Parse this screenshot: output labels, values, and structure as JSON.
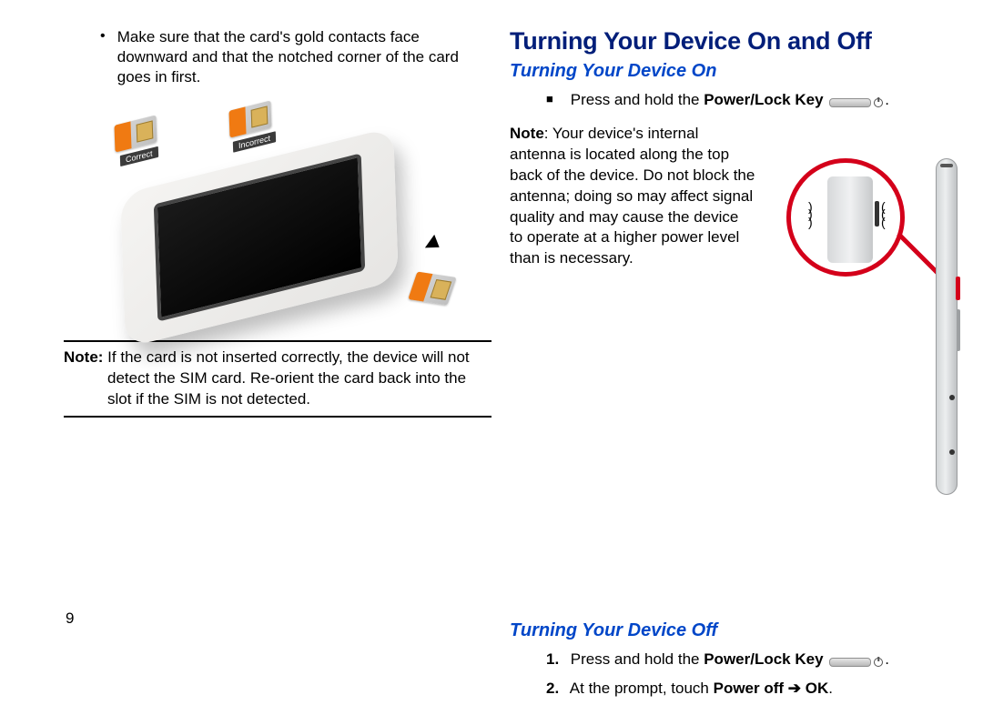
{
  "left": {
    "bullet": "Make sure that the card's gold contacts face downward and that the notched corner of the card goes in first.",
    "sim_correct_label": "Correct",
    "sim_incorrect_label": "Incorrect",
    "note_label": "Note:",
    "note_body_first": " If the card is not inserted correctly, the device will not",
    "note_body_rest": "detect the SIM card. Re-orient the card back into the slot if the SIM is not detected."
  },
  "right": {
    "h1": "Turning Your Device On and Off",
    "on_h2": "Turning Your Device On",
    "on_step_prefix": "Press and hold the ",
    "on_step_bold": "Power/Lock Key",
    "note_label": "Note",
    "note_body": ": Your device's internal antenna is located along the top back of the device. Do not block the antenna; doing so may affect signal quality and may cause the device to operate at a higher power level than is necessary.",
    "off_h2": "Turning Your Device Off",
    "off_step1_num": "1.",
    "off_step1_prefix": "Press and hold the ",
    "off_step1_bold": "Power/Lock Key",
    "off_step2_num": "2.",
    "off_step2_prefix": "At the prompt, touch ",
    "off_step2_bold": "Power off ➔ OK",
    "period": "."
  },
  "page_number": "9"
}
